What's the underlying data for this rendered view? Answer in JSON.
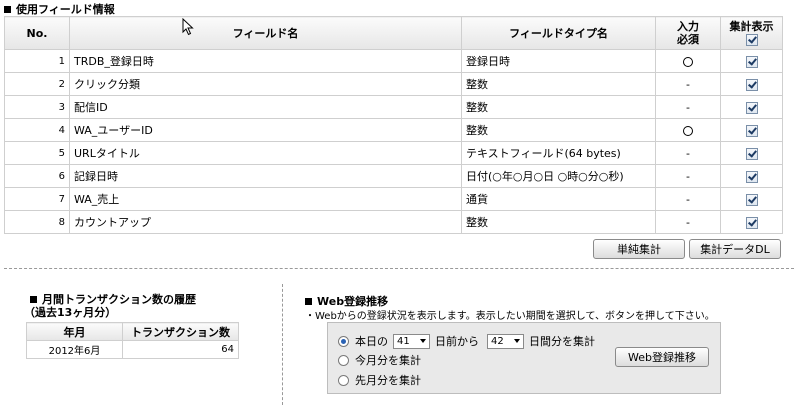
{
  "fields_section": {
    "title": "使用フィールド情報",
    "headers": {
      "no": "No.",
      "name": "フィールド名",
      "type": "フィールドタイプ名",
      "required_line1": "入力",
      "required_line2": "必須",
      "aggregate": "集計表示"
    },
    "rows": [
      {
        "no": "1",
        "name": "TRDB_登録日時",
        "type": "登録日時",
        "required": "circle",
        "aggregate": true
      },
      {
        "no": "2",
        "name": "クリック分類",
        "type": "整数",
        "required": "-",
        "aggregate": true
      },
      {
        "no": "3",
        "name": "配信ID",
        "type": "整数",
        "required": "-",
        "aggregate": true
      },
      {
        "no": "4",
        "name": "WA_ユーザーID",
        "type": "整数",
        "required": "circle",
        "aggregate": true
      },
      {
        "no": "5",
        "name": "URLタイトル",
        "type": "テキストフィールド(64 bytes)",
        "required": "-",
        "aggregate": true
      },
      {
        "no": "6",
        "name": "記録日時",
        "type": "日付(○年○月○日 ○時○分○秒)",
        "required": "-",
        "aggregate": true
      },
      {
        "no": "7",
        "name": "WA_売上",
        "type": "通貨",
        "required": "-",
        "aggregate": true
      },
      {
        "no": "8",
        "name": "カウントアップ",
        "type": "整数",
        "required": "-",
        "aggregate": true
      }
    ],
    "buttons": {
      "simple_aggregate": "単純集計",
      "aggregate_dl": "集計データDL"
    }
  },
  "history": {
    "title_line1": "月間トランザクション数の履歴",
    "title_line2": "（過去13ヶ月分）",
    "headers": {
      "month": "年月",
      "count": "トランザクション数"
    },
    "rows": [
      {
        "month": "2012年6月",
        "count": "64"
      }
    ]
  },
  "web": {
    "title": "Web登録推移",
    "description": "・Webからの登録状況を表示します。表示したい期間を選択して、ボタンを押して下さい。",
    "option1": {
      "prefix": "本日の",
      "days_ago": "41",
      "middle": "日前から",
      "span": "42",
      "suffix": "日間分を集計",
      "selected": true
    },
    "option2": {
      "label": "今月分を集計",
      "selected": false
    },
    "option3": {
      "label": "先月分を集計",
      "selected": false
    },
    "button": "Web登録推移"
  }
}
